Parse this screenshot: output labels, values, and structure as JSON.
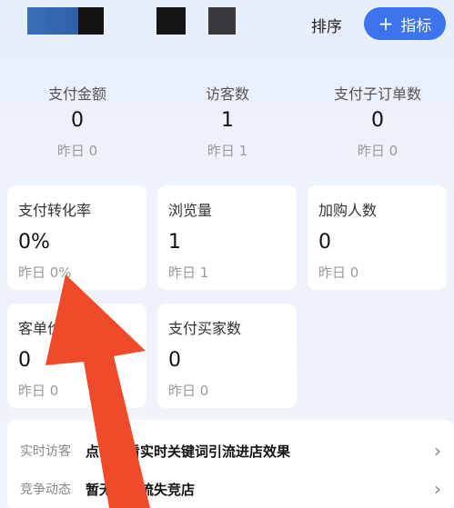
{
  "header": {
    "sort_label": "排序",
    "add_label": "指标",
    "add_icon": "+"
  },
  "stats_top": [
    {
      "label": "支付金额",
      "value": "0",
      "yesterday": "昨日 0"
    },
    {
      "label": "访客数",
      "value": "1",
      "yesterday": "昨日 1"
    },
    {
      "label": "支付子订单数",
      "value": "0",
      "yesterday": "昨日 0"
    }
  ],
  "cards": [
    {
      "label": "支付转化率",
      "value": "0%",
      "yesterday": "昨日 0%"
    },
    {
      "label": "浏览量",
      "value": "1",
      "yesterday": "昨日 1"
    },
    {
      "label": "加购人数",
      "value": "0",
      "yesterday": "昨日 0"
    },
    {
      "label": "客单价",
      "value": "0",
      "yesterday": "昨日 0"
    },
    {
      "label": "支付买家数",
      "value": "0",
      "yesterday": "昨日 0"
    }
  ],
  "rows": [
    {
      "key": "实时访客",
      "value": "点击查看实时关键词引流进店效果"
    },
    {
      "key": "竞争动态",
      "value": "暂无发现流失竞店"
    }
  ],
  "colors": {
    "accent": "#3d74ee",
    "arrow": "#f04a2a"
  }
}
